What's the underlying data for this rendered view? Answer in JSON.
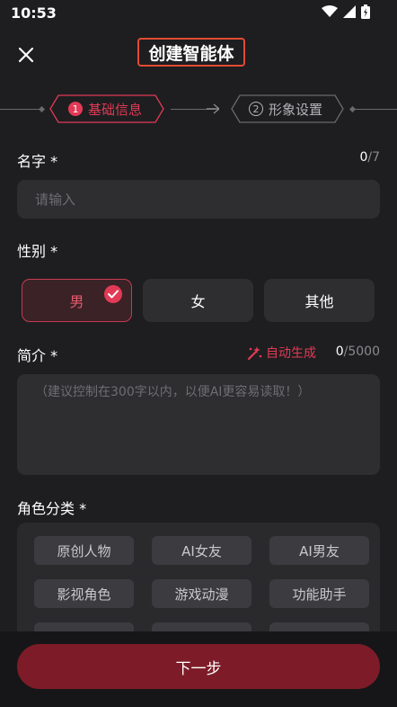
{
  "status_bar": {
    "time": "10:53",
    "icons": [
      "wifi-icon",
      "signal-icon",
      "battery-icon"
    ]
  },
  "header": {
    "title": "创建智能体",
    "close_icon": "close-icon"
  },
  "steps": [
    {
      "number": "1",
      "label": "基础信息",
      "active": true
    },
    {
      "number": "②",
      "label": "形象设置",
      "active": false
    }
  ],
  "name_field": {
    "label": "名字 *",
    "count": "0",
    "max": "/7",
    "placeholder": "请输入"
  },
  "gender_field": {
    "label": "性别 *",
    "options": [
      "男",
      "女",
      "其他"
    ],
    "selected": "男"
  },
  "intro_field": {
    "label": "简介 *",
    "auto_generate": "自动生成",
    "count": "0",
    "max": "/5000",
    "placeholder": "（建议控制在300字以内，以便AI更容易读取！）"
  },
  "category_field": {
    "label": "角色分类 *",
    "chips": [
      [
        "原创人物",
        "AI女友",
        "AI男友"
      ],
      [
        "影视角色",
        "游戏动漫",
        "功能助手"
      ]
    ]
  },
  "footer": {
    "next_label": "下一步"
  },
  "colors": {
    "accent": "#e23a56",
    "next_button": "#7d1c28",
    "background": "#1e1e20"
  }
}
